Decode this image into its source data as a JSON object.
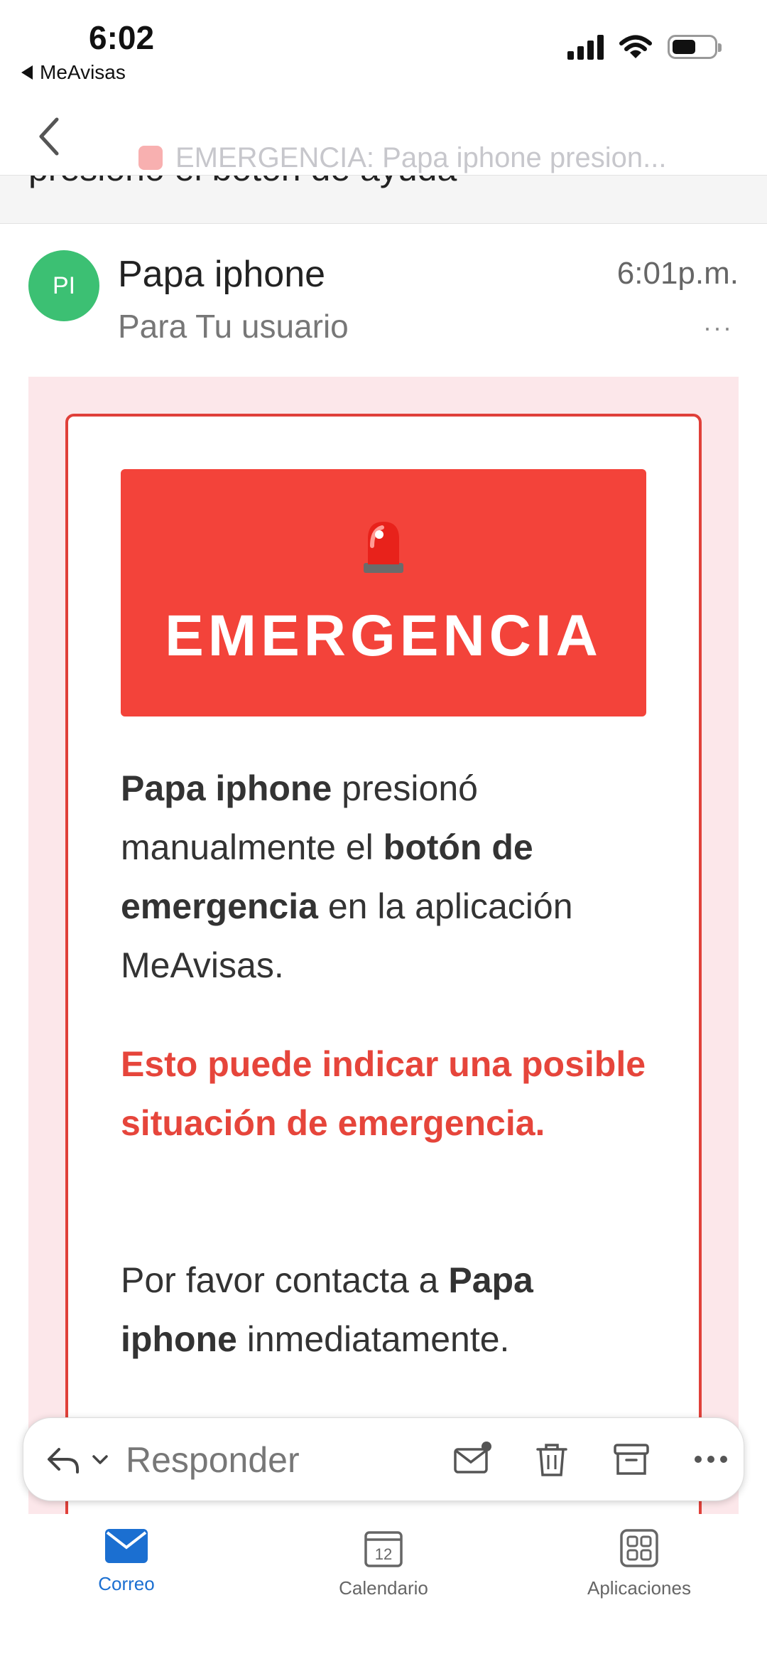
{
  "status": {
    "time": "6:02",
    "back_app": "MeAvisas"
  },
  "nav": {
    "title": "EMERGENCIA: Papa iphone presion..."
  },
  "subject_peek": "presionó el botón de ayuda",
  "message": {
    "avatar_initials": "PI",
    "sender": "Papa iphone",
    "recipient": "Para Tu usuario",
    "time": "6:01p.m.",
    "more": "···"
  },
  "body": {
    "banner_title": "EMERGENCIA",
    "p1": {
      "name": "Papa iphone",
      "t1": " presionó manualmente el ",
      "b2": "botón de emergencia",
      "t2": " en la aplicación MeAvisas."
    },
    "warning": "Esto puede indicar una posible situación de emergencia.",
    "p3": {
      "t1": "Por favor contacta a ",
      "name": "Papa iphone",
      "t2": " inmediatamente."
    }
  },
  "reply_bar": {
    "label": "Responder"
  },
  "tabs": [
    {
      "label": "Correo",
      "icon": "mail-icon",
      "active": true
    },
    {
      "label": "Calendario",
      "icon": "calendar-icon",
      "day": "12"
    },
    {
      "label": "Aplicaciones",
      "icon": "apps-grid-icon"
    }
  ],
  "colors": {
    "emergency_red": "#f3433a",
    "warning_text": "#e6453b",
    "accent_blue": "#1b6fd1",
    "avatar_green": "#3cc073",
    "email_bg": "#fce7ea"
  }
}
